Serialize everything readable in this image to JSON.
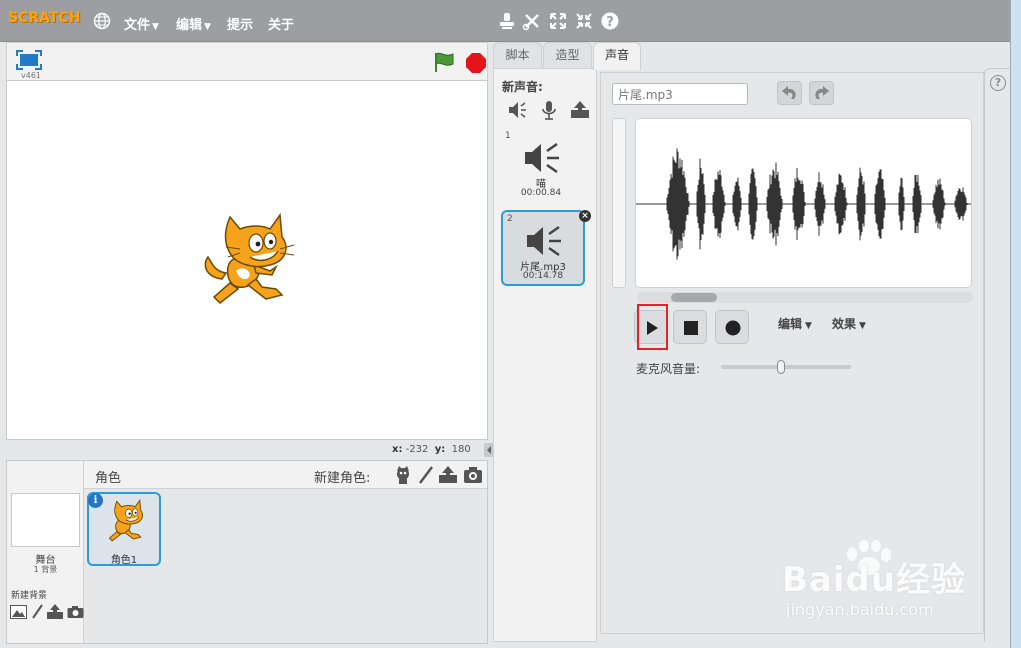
{
  "menubar": {
    "logo_text": "SCRATCH",
    "menus": [
      {
        "label": "文件",
        "has_caret": true
      },
      {
        "label": "编辑",
        "has_caret": true
      },
      {
        "label": "提示",
        "has_caret": false
      },
      {
        "label": "关于",
        "has_caret": false
      }
    ],
    "tools": [
      "duplicate-stamp-icon",
      "cut-scissors-icon",
      "grow-icon",
      "shrink-icon",
      "help-question-icon"
    ]
  },
  "stage": {
    "version": "v461",
    "coords": {
      "x_label": "x:",
      "x_value": "-232",
      "y_label": "y:",
      "y_value": "180"
    }
  },
  "sprite_pane": {
    "title": "角色",
    "new_sprite_label": "新建角色:",
    "stage_label": "舞台",
    "stage_backdrop_count": "1 背景",
    "new_backdrop_label": "新建背景",
    "sprites": [
      {
        "name": "角色1",
        "info_glyph": "i"
      }
    ]
  },
  "tabs": [
    {
      "label": "脚本",
      "active": false
    },
    {
      "label": "造型",
      "active": false
    },
    {
      "label": "声音",
      "active": true
    }
  ],
  "sound_list": {
    "new_sound_label": "新声音:",
    "sounds": [
      {
        "index": "1",
        "name": "喵",
        "duration": "00:00.84",
        "selected": false
      },
      {
        "index": "2",
        "name": "片尾.mp3",
        "duration": "00:14.78",
        "selected": true
      }
    ]
  },
  "editor": {
    "sound_name_value": "片尾.mp3",
    "edit_menu_label": "编辑",
    "effects_menu_label": "效果",
    "mic_volume_label": "麦克风音量:",
    "mic_volume_level": 0.46,
    "scroll_position": 0.1
  },
  "watermark": {
    "brand": "Baidu经验",
    "url": "jingyan.baidu.com"
  },
  "colors": {
    "accent": "#2d9cd4",
    "menubar": "#9c9ea2",
    "highlight": "#e0242a",
    "flag": "#3a8a2c",
    "stop": "#e3141b",
    "cat_orange": "#f7a21b"
  }
}
